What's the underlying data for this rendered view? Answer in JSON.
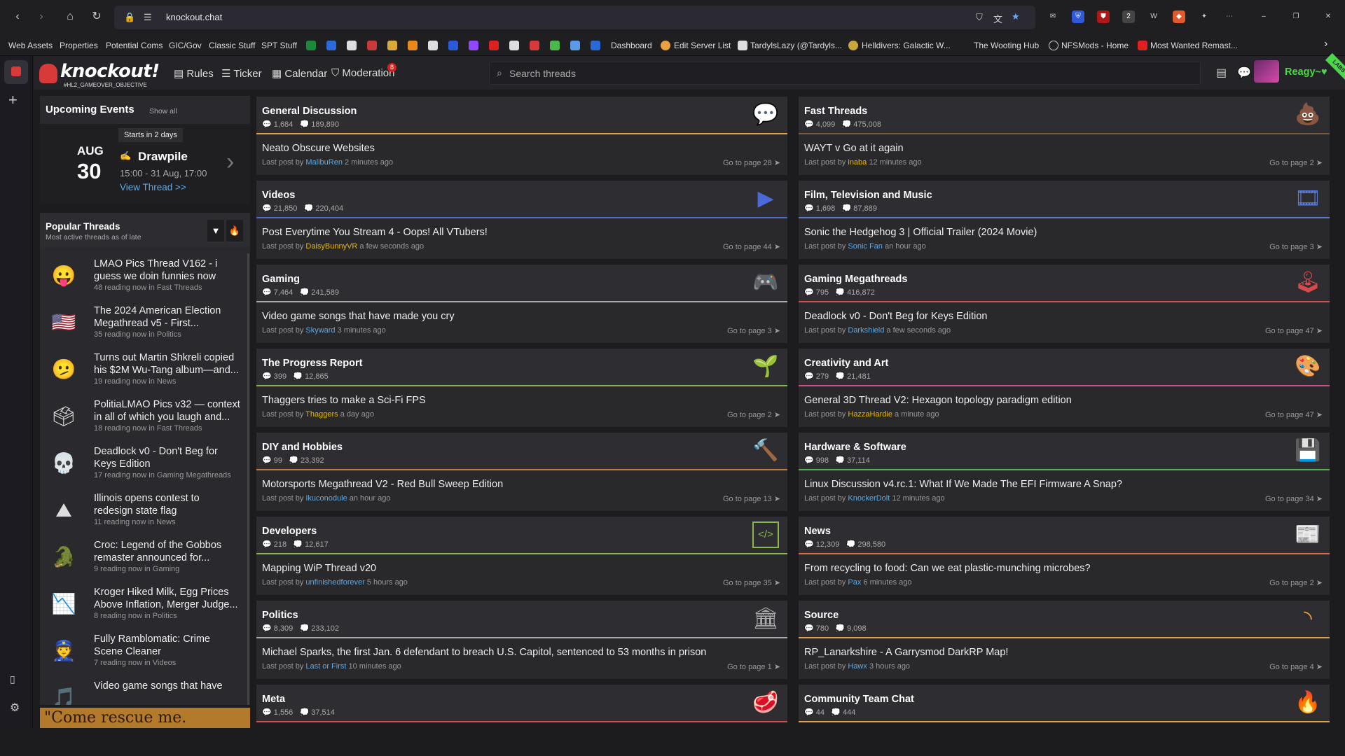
{
  "browser": {
    "url": "knockout.chat",
    "back_icon": "arrow-left-icon",
    "forward_icon": "arrow-right-icon",
    "home_icon": "home-icon",
    "reload_icon": "reload-icon",
    "ext_badge": "2"
  },
  "bookmarks": [
    {
      "label": "Web Assets"
    },
    {
      "label": "Properties"
    },
    {
      "label": "Potential Coms"
    },
    {
      "label": "GIC/Gov"
    },
    {
      "label": "Classic Stuff"
    },
    {
      "label": "SPT Stuff"
    },
    {
      "label": "Dashboard"
    },
    {
      "label": "Edit Server List"
    },
    {
      "label": "TardylsLazy (@Tardyls..."
    },
    {
      "label": "Helldivers: Galactic W..."
    },
    {
      "label": "The Wooting Hub"
    },
    {
      "label": "NFSMods - Home"
    },
    {
      "label": "Most Wanted Remast..."
    }
  ],
  "site": {
    "logo": "knockout!",
    "tagline": "#HL2_GAMEOVER_OBJECTIVE",
    "nav": {
      "rules": "Rules",
      "ticker": "Ticker",
      "calendar": "Calendar",
      "moderation": "Moderation",
      "moderation_badge": "8"
    },
    "search_placeholder": "Search threads",
    "username": "Reagy~♥",
    "ribbon": "LABS"
  },
  "events": {
    "title": "Upcoming Events",
    "show_all": "Show all",
    "starts_in": "Starts in 2 days",
    "month": "AUG",
    "day": "30",
    "name": "Drawpile",
    "time": "15:00 - 31 Aug, 17:00",
    "view": "View Thread >>"
  },
  "popular": {
    "title": "Popular Threads",
    "subtitle": "Most active threads as of late",
    "items": [
      {
        "title": "LMAO Pics Thread V162 - i guess we doin funnies now",
        "meta": "48 reading now in Fast Threads",
        "icon": "😛"
      },
      {
        "title": "The 2024 American Election Megathread v5 - First...",
        "meta": "35 reading now in Politics",
        "icon": "🇺🇸"
      },
      {
        "title": "Turns out Martin Shkreli copied his $2M Wu-Tang album—and...",
        "meta": "19 reading now in News",
        "icon": "🫤"
      },
      {
        "title": "PolitiaLMAO Pics v32 — context in all of which you laugh and...",
        "meta": "18 reading now in Fast Threads",
        "icon": "🗳"
      },
      {
        "title": "Deadlock v0 - Don't Beg for Keys Edition",
        "meta": "17 reading now in Gaming Megathreads",
        "icon": "💀"
      },
      {
        "title": "Illinois opens contest to redesign state flag",
        "meta": "11 reading now in News",
        "icon": "⛰"
      },
      {
        "title": "Croc: Legend of the Gobbos remaster announced for...",
        "meta": "9 reading now in Gaming",
        "icon": "🐊"
      },
      {
        "title": "Kroger Hiked Milk, Egg Prices Above Inflation, Merger Judge...",
        "meta": "8 reading now in Politics",
        "icon": "📉"
      },
      {
        "title": "Fully Ramblomatic: Crime Scene Cleaner",
        "meta": "7 reading now in Videos",
        "icon": "👮"
      },
      {
        "title": "Video game songs that have",
        "meta": "",
        "icon": "🎵"
      }
    ]
  },
  "promo": {
    "text": "\"Come rescue me."
  },
  "subforums": [
    {
      "name": "General Discussion",
      "threads": "1,684",
      "posts": "189,890",
      "icon": "💬",
      "color": "#e8a040",
      "thread": "Neato Obscure Websites",
      "user": "MalibuRen",
      "gold": false,
      "time": "2 minutes ago",
      "page": "Go to page 28 ➤"
    },
    {
      "name": "Fast Threads",
      "threads": "4,099",
      "posts": "475,008",
      "icon": "💩",
      "color": "#7a5a3a",
      "thread": "WAYT v Go at it again",
      "user": "inaba",
      "gold": true,
      "time": "12 minutes ago",
      "page": "Go to page 2 ➤"
    },
    {
      "name": "Videos",
      "threads": "21,850",
      "posts": "220,404",
      "icon": "▶",
      "color": "#4a6ad8",
      "thread": "Post Everytime You Stream 4 - Oops! All VTubers!",
      "user": "DaisyBunnyVR",
      "gold": true,
      "time": "a few seconds ago",
      "page": "Go to page 44 ➤"
    },
    {
      "name": "Film, Television and Music",
      "threads": "1,698",
      "posts": "87,889",
      "icon": "🎞",
      "color": "#5a7ad8",
      "thread": "Sonic the Hedgehog 3 | Official Trailer (2024 Movie)",
      "user": "Sonic Fan",
      "gold": false,
      "time": "an hour ago",
      "page": "Go to page 3 ➤"
    },
    {
      "name": "Gaming",
      "threads": "7,464",
      "posts": "241,589",
      "icon": "🎮",
      "color": "#aaaaaa",
      "thread": "Video game songs that have made you cry",
      "user": "Skyward",
      "gold": false,
      "time": "3 minutes ago",
      "page": "Go to page 3 ➤"
    },
    {
      "name": "Gaming Megathreads",
      "threads": "795",
      "posts": "416,872",
      "icon": "🕹",
      "color": "#d84a4a",
      "thread": "Deadlock v0 - Don't Beg for Keys Edition",
      "user": "Darkshield",
      "gold": false,
      "time": "a few seconds ago",
      "page": "Go to page 47 ➤"
    },
    {
      "name": "The Progress Report",
      "threads": "399",
      "posts": "12,865",
      "icon": "🌱",
      "color": "#7ab84a",
      "thread": "Thaggers tries to make a Sci-Fi FPS",
      "user": "Thaggers",
      "gold": true,
      "time": "a day ago",
      "page": "Go to page 2 ➤"
    },
    {
      "name": "Creativity and Art",
      "threads": "279",
      "posts": "21,481",
      "icon": "🎨",
      "color": "#d84a8a",
      "thread": "General 3D Thread V2: Hexagon topology paradigm edition",
      "user": "HazzaHardie",
      "gold": true,
      "time": "a minute ago",
      "page": "Go to page 47 ➤"
    },
    {
      "name": "DIY and Hobbies",
      "threads": "99",
      "posts": "23,392",
      "icon": "🔨",
      "color": "#c87a3a",
      "thread": "Motorsports Megathread V2 - Red Bull Sweep Edition",
      "user": "Ikuconodule",
      "gold": false,
      "time": "an hour ago",
      "page": "Go to page 13 ➤"
    },
    {
      "name": "Hardware & Software",
      "threads": "998",
      "posts": "37,114",
      "icon": "💾",
      "color": "#4ab84a",
      "thread": "Linux Discussion v4.rc.1: What If We Made The EFI Firmware A Snap?",
      "user": "KnockerDolt",
      "gold": false,
      "time": "12 minutes ago",
      "page": "Go to page 34 ➤"
    },
    {
      "name": "Developers",
      "threads": "218",
      "posts": "12,617",
      "icon": "</>",
      "color": "#8ab84a",
      "thread": "Mapping WiP Thread v20",
      "user": "unfinishedforever",
      "gold": false,
      "time": "5 hours ago",
      "page": "Go to page 35 ➤"
    },
    {
      "name": "News",
      "threads": "12,309",
      "posts": "298,580",
      "icon": "📰",
      "color": "#e86a3a",
      "thread": "From recycling to food: Can we eat plastic-munching microbes?",
      "user": "Pax",
      "gold": false,
      "time": "6 minutes ago",
      "page": "Go to page 2 ➤"
    },
    {
      "name": "Politics",
      "threads": "8,309",
      "posts": "233,102",
      "icon": "🏛",
      "color": "#aaaaaa",
      "thread": "Michael Sparks, the first Jan. 6 defendant to breach U.S. Capitol, sentenced to 53 months in prison",
      "user": "Last or First",
      "gold": false,
      "time": "10 minutes ago",
      "page": "Go to page 1 ➤"
    },
    {
      "name": "Source",
      "threads": "780",
      "posts": "9,098",
      "icon": "◝",
      "color": "#e8a040",
      "thread": "RP_Lanarkshire - A Garrysmod DarkRP Map!",
      "user": "Hawx",
      "gold": false,
      "time": "3 hours ago",
      "page": "Go to page 4 ➤"
    },
    {
      "name": "Meta",
      "threads": "1,556",
      "posts": "37,514",
      "icon": "🥩",
      "color": "#d84a4a",
      "thread": "",
      "user": "",
      "gold": false,
      "time": "",
      "page": ""
    },
    {
      "name": "Community Team Chat",
      "threads": "44",
      "posts": "444",
      "icon": "🔥",
      "color": "#e8a040",
      "thread": "",
      "user": "",
      "gold": false,
      "time": "",
      "page": ""
    }
  ]
}
